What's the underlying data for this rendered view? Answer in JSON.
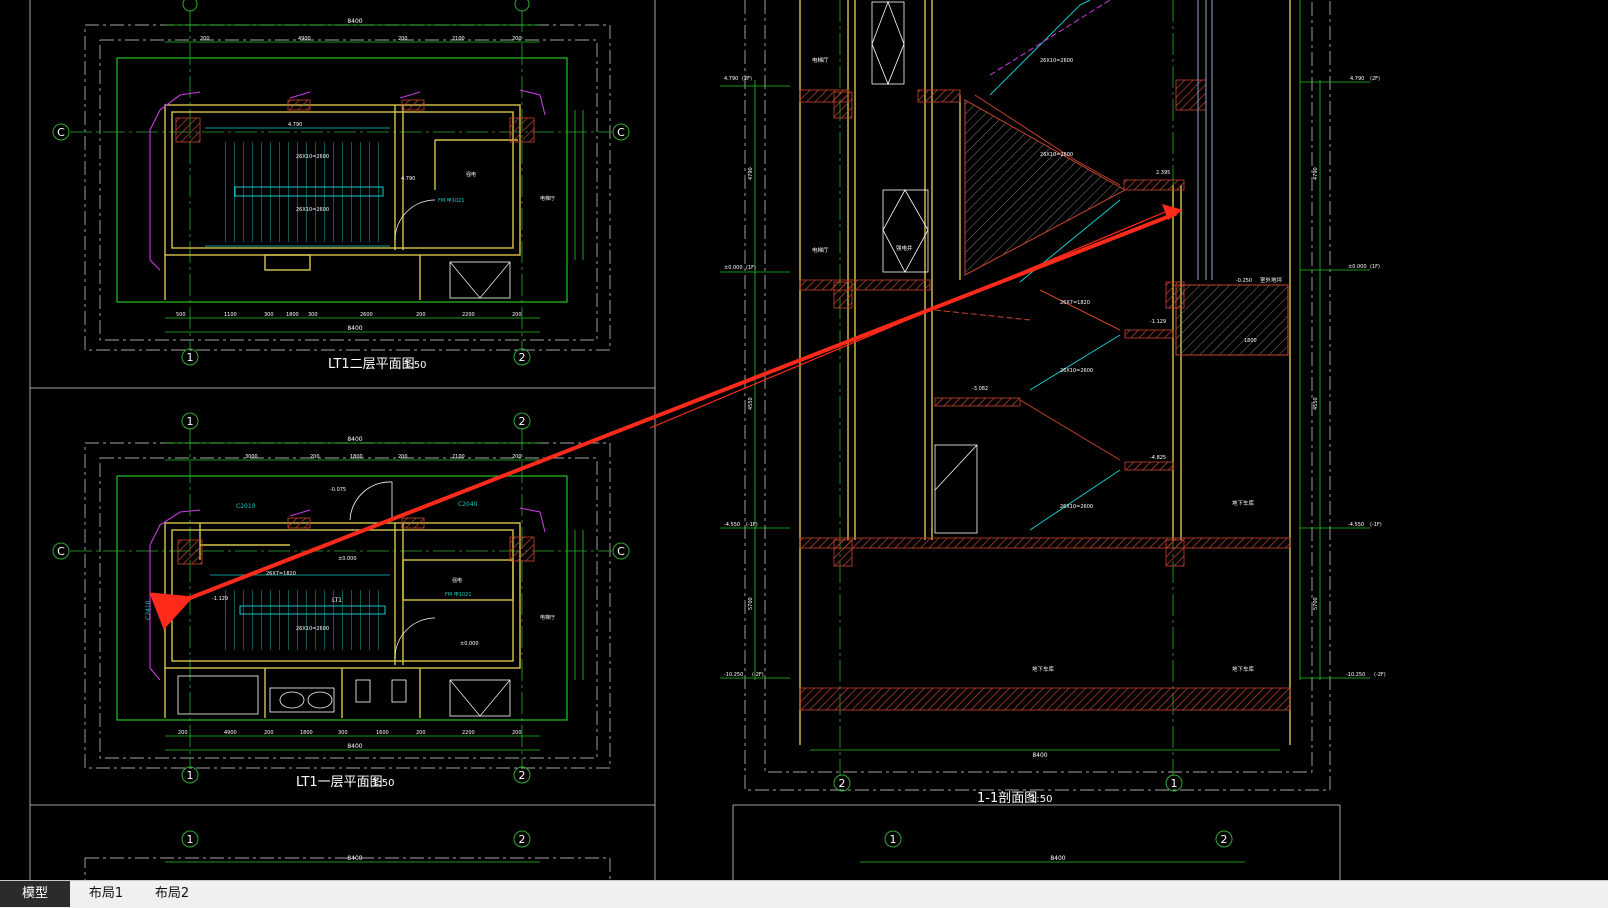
{
  "colors": {
    "background": "#000000",
    "wall": "#d6c64a",
    "stair": "#18c8c8",
    "dim": "#22c422",
    "axis": "#2ea82e",
    "hatch": "#c8442c",
    "magenta": "#c83ce0",
    "arrow": "#ff2a1a",
    "text": "#ffffff"
  },
  "plans": {
    "second": {
      "title": "LT1二层平面图",
      "scale": "1:50",
      "overall_dim": "8400",
      "axis_c": "C",
      "axis_1": "1",
      "axis_2": "2",
      "room_label": "电梯厅",
      "room_label_2": "强电",
      "elev_a": "4.790",
      "elev_b": "4.790",
      "stair_note": "26X10=2600",
      "stair_note_2": "26X10=2600",
      "door": "FM 甲1021",
      "top_dims": [
        "200",
        "4900",
        "200",
        "2100",
        "200"
      ],
      "bottom_dims": [
        "500",
        "1100",
        "300",
        "1800",
        "300",
        "2600",
        "200",
        "2200",
        "200"
      ]
    },
    "first": {
      "title": "LT1一层平面图",
      "scale": "1:50",
      "overall_dim": "8400",
      "axis_c": "C",
      "axis_1": "1",
      "axis_2": "2",
      "room_label": "电梯厅",
      "room_label_2": "强电",
      "stair_label": "LT1",
      "window_a": "C2010",
      "window_b": "C2040",
      "window_c": "C2410",
      "elev_a": "-0.075",
      "elev_b": "±0.000",
      "elev_c": "-1.129",
      "elev_d": "±0.000",
      "stair_note": "26X7=1820",
      "stair_note_2": "26X10=2600",
      "door": "FM 甲1021",
      "top_dims": [
        "3000",
        "200",
        "1800",
        "200",
        "2100",
        "200"
      ],
      "bottom_dims": [
        "200",
        "4900",
        "200",
        "1800",
        "300",
        "1600",
        "200",
        "2200",
        "200"
      ]
    },
    "third_partial": {
      "overall_dim": "8400",
      "axis_1": "1",
      "axis_2": "2"
    }
  },
  "section": {
    "title": "1-1剖面图",
    "scale": "1:50",
    "overall_dim": "8400",
    "axis_2": "2",
    "axis_1": "1",
    "elev_2f": "4.790",
    "elev_2f_tag": "(2F)",
    "elev_1f": "±0.000",
    "elev_1f_tag": "(1F)",
    "elev_b1": "-4.550",
    "elev_b1_tag": "(-1F)",
    "elev_b2": "-10.250",
    "elev_b2_tag": "(-2F)",
    "elev_right_2f": "4.790",
    "elev_right_1f": "±0.000",
    "elev_right_b1": "-4.550",
    "elev_right_b2": "-10.250",
    "room_elevator_top": "电梯厅",
    "room_elevator_mid": "电梯厅",
    "room_power": "强电井",
    "room_garage_a": "地下车库",
    "room_garage_b": "地下车库",
    "room_garage_c": "地下车库",
    "room_outside": "室外地坪",
    "landing_a": "2.395",
    "landing_b": "-0.250",
    "landing_c": "-1.129",
    "landing_d": "-3.082",
    "landing_e": "-4.825",
    "stair_note_a": "26X10=2600",
    "stair_note_b": "26X10=2600",
    "stair_note_c": "26X7=1820",
    "stair_note_d": "26X10=2600",
    "stair_note_e": "26X10=2600",
    "dim_1800": "1800",
    "side_dims_left": [
      "4790",
      "4550",
      "5700"
    ],
    "side_dims_right": [
      "4790",
      "4550",
      "5700"
    ]
  },
  "annotation": {
    "arrow_label": ""
  },
  "tabs": [
    {
      "label": "模型",
      "active": true
    },
    {
      "label": "布局1",
      "active": false
    },
    {
      "label": "布局2",
      "active": false
    }
  ]
}
